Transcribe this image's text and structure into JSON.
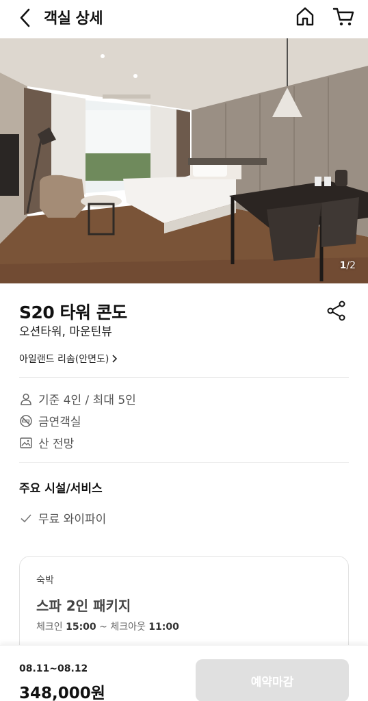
{
  "header": {
    "title": "객실 상세",
    "back_icon": "chevron-left-icon",
    "home_icon": "home-icon",
    "cart_icon": "cart-icon"
  },
  "gallery": {
    "current": "1",
    "total": "/2"
  },
  "room": {
    "name": "S20 타워 콘도",
    "subtitle": "오션타워, 마운틴뷰",
    "hotel_link": "아일랜드 리솜(안면도)",
    "share_icon": "share-icon"
  },
  "info": [
    {
      "icon": "person-icon",
      "text": "기준 4인 / 최대 5인"
    },
    {
      "icon": "no-smoking-icon",
      "text": "금연객실"
    },
    {
      "icon": "image-icon",
      "text": "산 전망"
    }
  ],
  "facilities": {
    "title": "주요 시설/서비스",
    "items": [
      {
        "icon": "check-icon",
        "text": "무료 와이파이"
      }
    ]
  },
  "package": {
    "type": "숙박",
    "title": "스파 2인 패키지",
    "checkin_label": "체크인",
    "checkin_time": "15:00",
    "separator": "~",
    "checkout_label": "체크아웃",
    "checkout_time": "11:00"
  },
  "bottom": {
    "dates": "08.11~08.12",
    "price": "348,000원",
    "book_label": "예약마감"
  },
  "colors": {
    "disabled_button": "#e0e0e0",
    "divider": "#ececec",
    "text_secondary": "#555555"
  }
}
